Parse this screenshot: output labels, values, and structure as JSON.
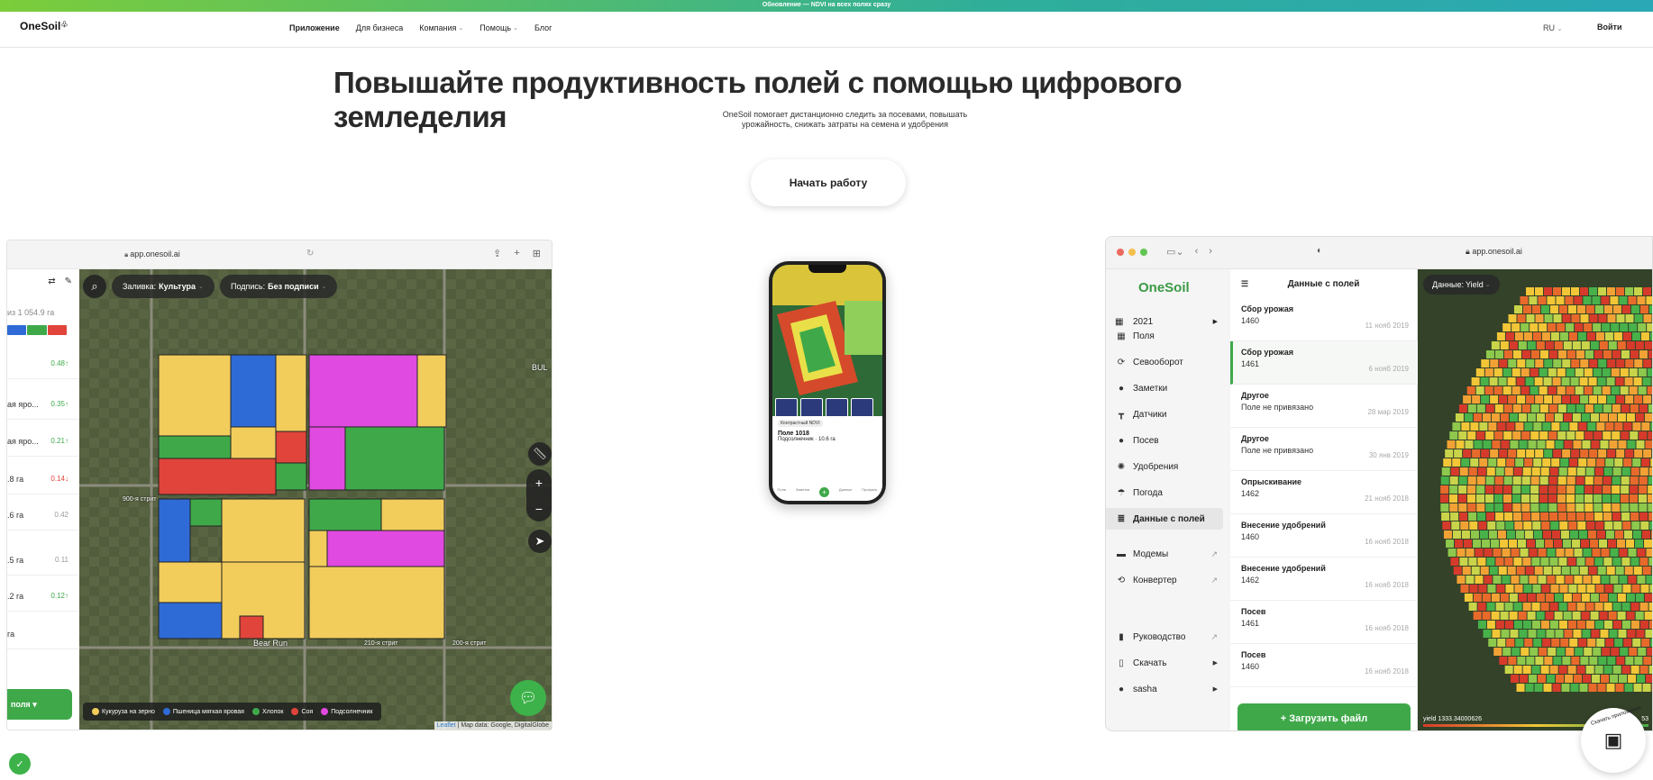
{
  "announcement": "Обновление — NDVI на всех полях сразу",
  "header": {
    "logo": "OneSoil",
    "nav": [
      {
        "label": "Приложение",
        "dropdown": false
      },
      {
        "label": "Для бизнеса",
        "dropdown": false
      },
      {
        "label": "Компания",
        "dropdown": true
      },
      {
        "label": "Помощь",
        "dropdown": true
      },
      {
        "label": "Блог",
        "dropdown": false
      }
    ],
    "language": "RU",
    "login": "Войти"
  },
  "hero": {
    "title": "Повышайте продуктивность полей с помощью цифрового земледелия",
    "subtitle": "OneSoil помогает дистанционно следить за посевами, повышать урожайность, снижать затраты на семена и удобрения",
    "cta": "Начать работу"
  },
  "web_app": {
    "url": "app.onesoil.ai",
    "sidebar": {
      "area_text": "из 1 054.9 га",
      "colorbar": [
        "#2f6bd6",
        "#3fa94a",
        "#e0443a"
      ],
      "rows": [
        {
          "label": "",
          "value": "0.48↑",
          "value_color": "#3fa94a"
        },
        {
          "label": "ая яро...",
          "value": "0.35↑",
          "value_color": "#3fa94a"
        },
        {
          "label": "ая яро...",
          "value": "0.21↑",
          "value_color": "#3fa94a"
        },
        {
          "label": ".8 га",
          "value": "0.14↓",
          "value_color": "#e0443a"
        },
        {
          "label": ".6 га",
          "value": "0.42",
          "value_color": "#999999"
        },
        {
          "label": ".5 га",
          "value": "0.11",
          "value_color": "#999999"
        },
        {
          "label": ".2 га",
          "value": "0.12↑",
          "value_color": "#3fa94a"
        },
        {
          "label": "га",
          "value": "",
          "value_color": "#999999"
        }
      ],
      "add_button": "поля"
    },
    "fill_label": "Заливка:",
    "fill_value": "Культура",
    "caption_label": "Подпись:",
    "caption_value": "Без подписи",
    "map_labels": [
      "900-я стрит",
      "Bear Run",
      "210-я стрит",
      "200-я стрит",
      "BUL"
    ],
    "legend": [
      {
        "label": "Кукуруза на зерно",
        "color": "#f2cd5c"
      },
      {
        "label": "Пшеница мягкая яровая",
        "color": "#2f6bd6"
      },
      {
        "label": "Хлопок",
        "color": "#3fa94a"
      },
      {
        "label": "Соя",
        "color": "#e0443a"
      },
      {
        "label": "Подсолнечник",
        "color": "#e14ae0"
      }
    ],
    "attribution_link": "Leaflet",
    "attribution_text": "| Map data: Google, DigitalGlobe"
  },
  "mobile_app": {
    "field_name": "Поле 1018",
    "field_meta": "Подсолнечник · 10.6 га",
    "ndvi_label": "Контрастный NDVI",
    "tabs": [
      "Поля",
      "Заметки",
      "Добавить",
      "Данные",
      "Профиль"
    ]
  },
  "desktop_app": {
    "url": "app.onesoil.ai",
    "brand": "OneSoil",
    "year": "2021",
    "menu": [
      {
        "label": "Поля",
        "icon": "fields-icon",
        "glyph": "▦",
        "external": false,
        "active": false
      },
      {
        "label": "Севооборот",
        "icon": "rotation-icon",
        "glyph": "⟳",
        "external": false,
        "active": false
      },
      {
        "label": "Заметки",
        "icon": "pin-icon",
        "glyph": "●",
        "external": false,
        "active": false
      },
      {
        "label": "Датчики",
        "icon": "sensor-icon",
        "glyph": "┳",
        "external": false,
        "active": false
      },
      {
        "label": "Посев",
        "icon": "seed-icon",
        "glyph": "●",
        "external": false,
        "active": false
      },
      {
        "label": "Удобрения",
        "icon": "fertilizer-icon",
        "glyph": "✺",
        "external": false,
        "active": false
      },
      {
        "label": "Погода",
        "icon": "umbrella-icon",
        "glyph": "☂",
        "external": false,
        "active": false
      },
      {
        "label": "Данные с полей",
        "icon": "database-icon",
        "glyph": "≣",
        "external": false,
        "active": true
      },
      {
        "label": "Модемы",
        "icon": "modem-icon",
        "glyph": "▬",
        "external": true,
        "active": false
      },
      {
        "label": "Конвертер",
        "icon": "converter-icon",
        "glyph": "⟲",
        "external": true,
        "active": false
      },
      {
        "label": "Руководство",
        "icon": "book-icon",
        "glyph": "▮",
        "external": true,
        "active": false
      },
      {
        "label": "Скачать",
        "icon": "download-icon",
        "glyph": "▯",
        "external": false,
        "active": false
      },
      {
        "label": "sasha",
        "icon": "user-icon",
        "glyph": "●",
        "external": false,
        "active": false
      }
    ],
    "list_title": "Данные с полей",
    "records": [
      {
        "type": "Сбор урожая",
        "field": "1460",
        "date": "11 нояб 2019",
        "selected": false
      },
      {
        "type": "Сбор урожая",
        "field": "1461",
        "date": "6 нояб 2019",
        "selected": true
      },
      {
        "type": "Другое",
        "field": "Поле не привязано",
        "date": "28 мар 2019",
        "selected": false
      },
      {
        "type": "Другое",
        "field": "Поле не привязано",
        "date": "30 янв 2019",
        "selected": false
      },
      {
        "type": "Опрыскивание",
        "field": "1462",
        "date": "21 нояб 2018",
        "selected": false
      },
      {
        "type": "Внесение удобрений",
        "field": "1460",
        "date": "16 нояб 2018",
        "selected": false
      },
      {
        "type": "Внесение удобрений",
        "field": "1462",
        "date": "16 нояб 2018",
        "selected": false
      },
      {
        "type": "Посев",
        "field": "1461",
        "date": "16 нояб 2018",
        "selected": false
      },
      {
        "type": "Посев",
        "field": "1460",
        "date": "16 нояб 2018",
        "selected": false
      }
    ],
    "upload_button": "+ Загрузить файл",
    "data_label": "Данные:",
    "data_value": "Yield",
    "yield_min": "yield 1333.34000626",
    "yield_max": "53"
  },
  "qr_badge": "Скачать приложение"
}
